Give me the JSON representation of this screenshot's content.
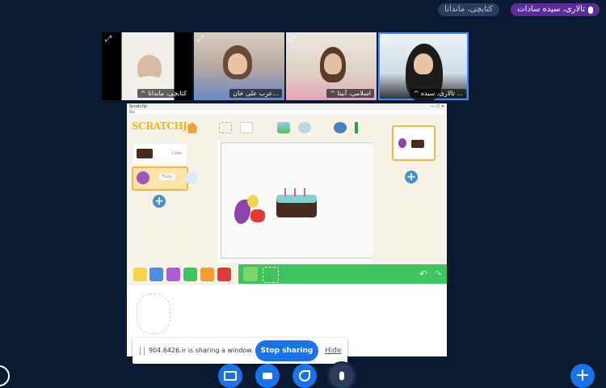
{
  "speakers": {
    "active": "تالاری، سیده سادات",
    "other": "کتابچی، ماندانا"
  },
  "tiles": [
    {
      "name": "^ کتابچی، ماندانا"
    },
    {
      "name": "عرب علی خان..."
    },
    {
      "name": "^ اسلامی، آنیتا"
    },
    {
      "name": "^ تالاری، سیده ..."
    }
  ],
  "window": {
    "title": "ScratchJr",
    "menu": "File"
  },
  "scratchjr": {
    "logo": "SCRATCHJr",
    "sprites": [
      {
        "label": "Cake"
      },
      {
        "label": "Fairy"
      }
    ]
  },
  "sharebar": {
    "message": "904.6426.ir is sharing a window.",
    "stop_label": "Stop sharing",
    "hide_label": "Hide"
  },
  "controls": {
    "plus": "+"
  },
  "colors": {
    "background": "#0b1a33",
    "accent": "#1a73e8",
    "active_pill": "#5b2e9a",
    "palette_green": "#3fc35f"
  }
}
